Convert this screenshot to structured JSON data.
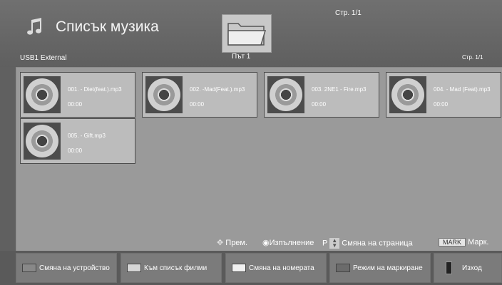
{
  "header": {
    "title": "Списък музика",
    "page_top": "Стр. 1/1",
    "device": "USB1 External",
    "path": "Път 1",
    "page_right": "Стр. 1/1"
  },
  "files": [
    {
      "name": "001. - Diet(feat.).mp3",
      "time": "00:00"
    },
    {
      "name": "002. -Mad(Feat.).mp3",
      "time": "00:00"
    },
    {
      "name": "003. 2NE1 - Fire.mp3",
      "time": "00:00"
    },
    {
      "name": "004. - Mad (Feat).mp3",
      "time": "00:00"
    },
    {
      "name": "005. - Gift.mp3",
      "time": "00:00"
    }
  ],
  "hints": {
    "move": "Прем.",
    "play": "Изпълнение",
    "p_label": "P",
    "page_change": "Смяна на страница",
    "mark_key": "MARK",
    "mark": "Марк."
  },
  "buttons": {
    "change_device": "Смяна на устройство",
    "to_movies": "Към списък филми",
    "change_numbers": "Смяна на номерата",
    "mark_mode": "Режим на маркиране",
    "exit": "Изход"
  },
  "colors": {
    "red": "#8b8b8b",
    "green": "#c8c8c8",
    "yellow": "#e8e8e8",
    "blue": "#6a6a6a"
  }
}
